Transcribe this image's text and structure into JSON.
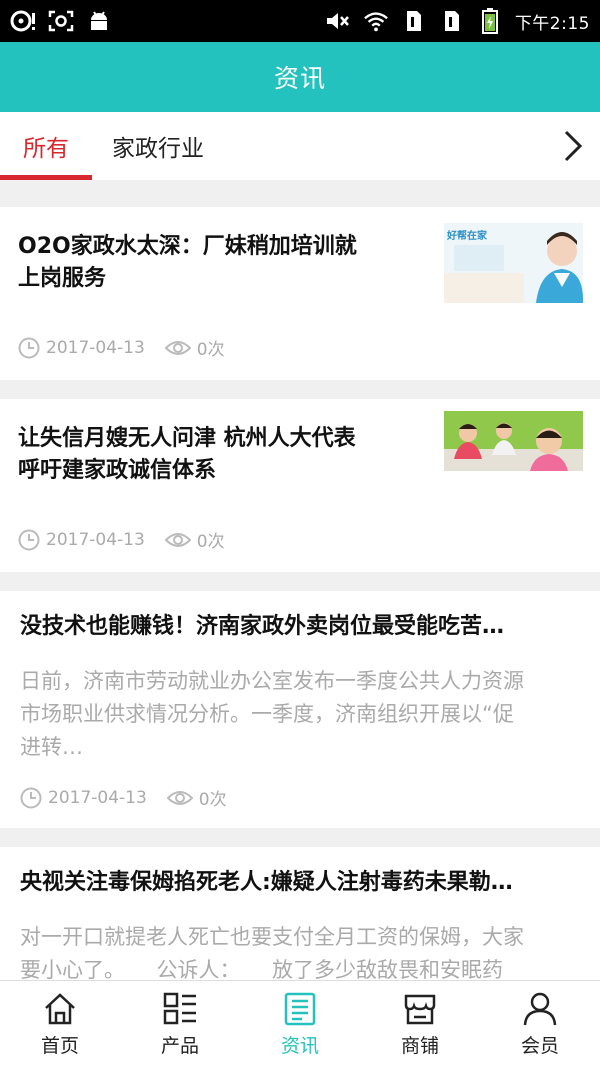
{
  "status_bar": {
    "time": "下午2:15",
    "left_icons": [
      "music-disc-icon",
      "screenshot-icon",
      "android-icon"
    ],
    "right_icons": [
      "mute-icon",
      "wifi-icon",
      "sim1-icon",
      "sim2-icon",
      "battery-icon"
    ]
  },
  "header": {
    "title": "资讯"
  },
  "tabs": {
    "items": [
      {
        "label": "所有",
        "active": true
      },
      {
        "label": "家政行业",
        "active": false
      }
    ],
    "more_icon": "chevron-right-icon"
  },
  "articles": [
    {
      "title_line1": "O2O家政水太深：厂妹稍加培训就",
      "title_line2": "上岗服务",
      "thumb_text": "好帮在家",
      "date": "2017-04-13",
      "views": "0次"
    },
    {
      "title_line1": "让失信月嫂无人问津 杭州人大代表",
      "title_line2": "呼吁建家政诚信体系",
      "date": "2017-04-13",
      "views": "0次"
    },
    {
      "title": "没技术也能赚钱！济南家政外卖岗位最受能吃苦…",
      "summary_line1": "日前，济南市劳动就业办公室发布一季度公共人力资源",
      "summary_line2": "市场职业供求情况分析。一季度，济南组织开展以“促",
      "summary_line3": "进转…",
      "date": "2017-04-13",
      "views": "0次"
    },
    {
      "title": "央视关注毒保姆掐死老人:嫌疑人注射毒药未果勒…",
      "summary_line1": "对一开口就提老人死亡也要支付全月工资的保姆，大家",
      "summary_line2": "要小心了。　　公诉人：　　放了多少敌敌畏和安眠药"
    }
  ],
  "bottom_nav": {
    "items": [
      {
        "label": "首页",
        "icon": "home-icon",
        "active": false
      },
      {
        "label": "产品",
        "icon": "product-grid-icon",
        "active": false
      },
      {
        "label": "资讯",
        "icon": "news-icon",
        "active": true
      },
      {
        "label": "商铺",
        "icon": "store-icon",
        "active": false
      },
      {
        "label": "会员",
        "icon": "member-icon",
        "active": false
      }
    ]
  },
  "colors": {
    "accent": "#23c2be",
    "tab_active": "#d7282d",
    "meta_text": "#aaaaaa",
    "background": "#f0f0f0"
  }
}
